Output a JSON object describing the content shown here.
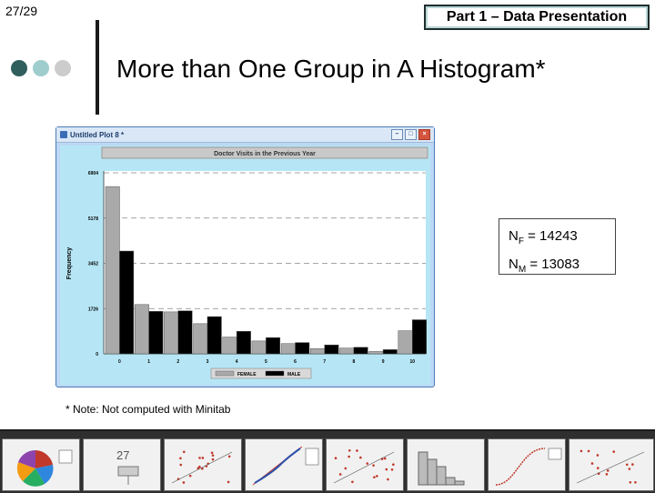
{
  "slide": {
    "number": "27/29",
    "section": "Part 1 – Data Presentation",
    "title": "More than One Group in A Histogram*"
  },
  "colors": {
    "dot1": "#2f5e5c",
    "dot2": "#9fcccc",
    "dot3": "#cccccc",
    "plot_bg": "#b6e6f5",
    "female": "#a9a9a9",
    "male": "#000000",
    "plot_title_bg": "#c9c9c9"
  },
  "window": {
    "title": "Untitled Plot 8 *",
    "controls": [
      "minimize-icon",
      "maximize-icon",
      "close-icon"
    ]
  },
  "chart_data": {
    "type": "bar",
    "title": "Doctor Visits in the Previous Year",
    "xlabel": "",
    "ylabel": "Frequency",
    "ylim": [
      0,
      6904
    ],
    "yticks": [
      0,
      1726,
      3452,
      5178,
      6904
    ],
    "categories": [
      "0",
      "1",
      "2",
      "3",
      "4",
      "5",
      "6",
      "7",
      "8",
      "9",
      "10"
    ],
    "series": [
      {
        "name": "FEMALE",
        "values": [
          6380,
          1880,
          1600,
          1150,
          640,
          490,
          390,
          200,
          220,
          90,
          880
        ]
      },
      {
        "name": "MALE",
        "values": [
          3920,
          1620,
          1640,
          1420,
          860,
          620,
          430,
          340,
          250,
          160,
          1300
        ]
      }
    ],
    "grid": "dashed horizontal",
    "legend": "bottom-center"
  },
  "note": "* Note: Not computed with Minitab",
  "counts": {
    "female_label": "N",
    "female_sub": "F",
    "female_value": "= 14243",
    "male_label": "N",
    "male_sub": "M",
    "male_value": "= 13083"
  },
  "thumbnails": [
    {
      "name": "pie-chart-thumbnail"
    },
    {
      "name": "boxplot-thumbnail",
      "label": "27"
    },
    {
      "name": "scatter-thumbnail-1"
    },
    {
      "name": "probability-plot-thumbnail"
    },
    {
      "name": "scatter-thumbnail-2"
    },
    {
      "name": "histogram-thumbnail"
    },
    {
      "name": "s-curve-thumbnail"
    },
    {
      "name": "scatter-thumbnail-3"
    },
    {
      "name": "small-histogram-thumbnail"
    }
  ]
}
